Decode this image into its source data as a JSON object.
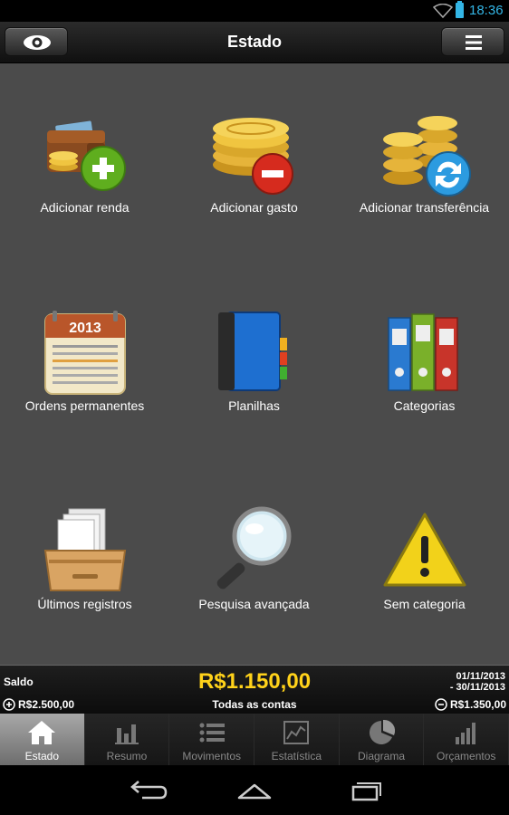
{
  "status_bar": {
    "time": "18:36"
  },
  "header": {
    "title": "Estado"
  },
  "grid": {
    "items": [
      {
        "label": "Adicionar renda",
        "icon": "wallet-add-icon"
      },
      {
        "label": "Adicionar gasto",
        "icon": "coins-remove-icon"
      },
      {
        "label": "Adicionar transferência",
        "icon": "coins-transfer-icon"
      },
      {
        "label": "Ordens permanentes",
        "icon": "calendar-icon"
      },
      {
        "label": "Planilhas",
        "icon": "notebook-icon"
      },
      {
        "label": "Categorias",
        "icon": "binders-icon"
      },
      {
        "label": "Últimos registros",
        "icon": "inbox-tray-icon"
      },
      {
        "label": "Pesquisa avançada",
        "icon": "magnifier-icon"
      },
      {
        "label": "Sem categoria",
        "icon": "warning-icon"
      }
    ],
    "calendar_year": "2013"
  },
  "summary": {
    "saldo_label": "Saldo",
    "balance": "R$1.150,00",
    "accounts": "Todas as contas",
    "date_from": "01/11/2013",
    "date_to": "- 30/11/2013",
    "income": "R$2.500,00",
    "expense": "R$1.350,00"
  },
  "tabs": [
    {
      "label": "Estado",
      "icon": "home-icon",
      "active": true
    },
    {
      "label": "Resumo",
      "icon": "bars-icon",
      "active": false
    },
    {
      "label": "Movimentos",
      "icon": "list-icon",
      "active": false
    },
    {
      "label": "Estatística",
      "icon": "line-chart-icon",
      "active": false
    },
    {
      "label": "Diagrama",
      "icon": "pie-chart-icon",
      "active": false
    },
    {
      "label": "Orçamentos",
      "icon": "ascending-bars-icon",
      "active": false
    }
  ],
  "colors": {
    "accent": "#33b5e5",
    "balance": "#ffd21a",
    "background": "#4b4b4b"
  }
}
